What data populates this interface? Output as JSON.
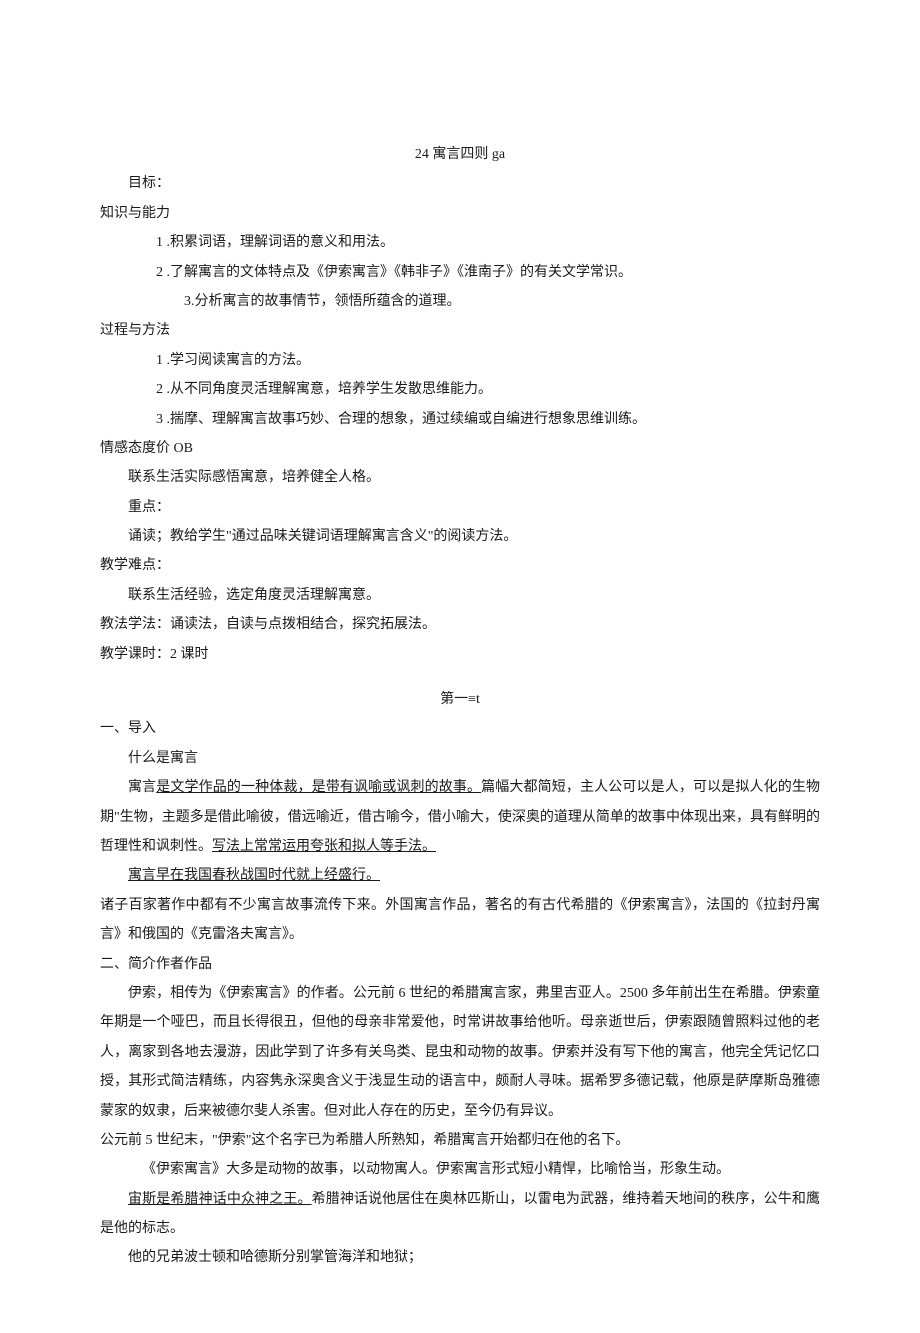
{
  "title": "24 寓言四则 ga",
  "section_goal_label": "目标：",
  "section_knowledge_label": "知识与能力",
  "knowledge_items": [
    "1 .积累词语，理解词语的意义和用法。",
    "2 .了解寓言的文体特点及《伊索寓言》《韩非子》《淮南子》的有关文学常识。",
    "3.分析寓言的故事情节，领悟所蕴含的道理。"
  ],
  "section_process_label": "过程与方法",
  "process_items": [
    "1 .学习阅读寓言的方法。",
    "2 .从不同角度灵活理解寓意，培养学生发散思维能力。",
    "3 .揣摩、理解寓言故事巧妙、合理的想象，通过续编或自编进行想象思维训练。"
  ],
  "section_emotion_label": "情感态度价 OB",
  "emotion_text": "联系生活实际感悟寓意，培养健全人格。",
  "focus_label": "重点：",
  "focus_text": "诵读；教给学生\"通过品味关键词语理解寓言含义\"的阅读方法。",
  "difficulty_label": "教学难点：",
  "difficulty_text": "联系生活经验，选定角度灵活理解寓意。",
  "method_text": "教法学法：诵读法，自读与点拨相结合，探究拓展法。",
  "period_text": "教学课时：2 课时",
  "lesson_heading": "第一≡t",
  "intro_label": "一、导入",
  "intro_q": "什么是寓言",
  "intro_para1_a": "寓言",
  "intro_para1_b_u": "是文学作品的一种体裁，是带有讽喻或讽刺的故事。",
  "intro_para1_c": "篇幅大都简短，主人公可以是人，可以是拟人化的生物期\"生物，主题多是借此喻彼，借远喻近，借古喻今，借小喻大，使深奥的道理从简单的故事中体现出来，具有鲜明的哲理性和讽刺性。",
  "intro_para1_d_u": "写法上常常运用夸张和拟人等手法。",
  "intro_para2_u": "寓言早在我国春秋战国时代就上经盛行。",
  "intro_para3": "诸子百家著作中都有不少寓言故事流传下来。外国寓言作品，著名的有古代希腊的《伊索寓言》，法国的《拉封丹寓言》和俄国的《克雷洛夫寓言》。",
  "author_label": "二、简介作者作品",
  "author_para1": "伊索，相传为《伊索寓言》的作者。公元前 6 世纪的希腊寓言家，弗里吉亚人。2500 多年前出生在希腊。伊索童年期是一个哑巴，而且长得很丑，但他的母亲非常爱他，时常讲故事给他听。母亲逝世后，伊索跟随曾照料过他的老人，离家到各地去漫游，因此学到了许多有关鸟类、昆虫和动物的故事。伊索并没有写下他的寓言，他完全凭记忆口授，其形式简洁精练，内容隽永深奥含义于浅显生动的语言中，颇耐人寻味。据希罗多德记载，他原是萨摩斯岛雅德蒙家的奴隶，后来被德尔斐人杀害。但对此人存在的历史，至今仍有异议。",
  "author_para2": "公元前 5 世纪末，\"伊索\"这个名字已为希腊人所熟知，希腊寓言开始都归在他的名下。",
  "author_para3": "《伊索寓言》大多是动物的故事，以动物寓人。伊索寓言形式短小精悍，比喻恰当，形象生动。",
  "author_para4_u": "宙斯是希腊神话中众神之王。",
  "author_para4_b": "希腊神话说他居住在奥林匹斯山，以雷电为武器，维持着天地间的秩序，公牛和鹰是他的标志。",
  "author_para5": "他的兄弟波士顿和哈德斯分别掌管海洋和地狱；"
}
